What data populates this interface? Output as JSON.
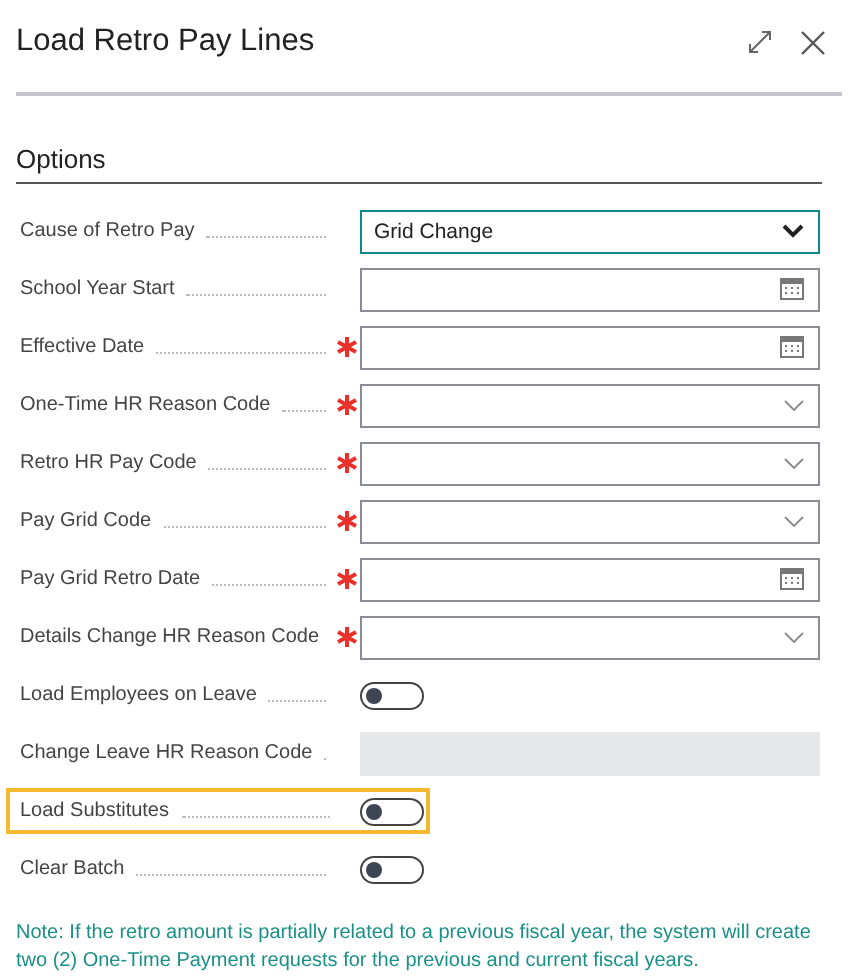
{
  "window": {
    "title": "Load Retro Pay Lines"
  },
  "section": {
    "title": "Options"
  },
  "rows": [
    {
      "label": "Cause of Retro Pay",
      "kind": "dropdown",
      "required": false,
      "value": "Grid Change",
      "focused": true,
      "highlighted": false
    },
    {
      "label": "School Year Start",
      "kind": "date",
      "required": false,
      "focused": false,
      "highlighted": false
    },
    {
      "label": "Effective Date",
      "kind": "date",
      "required": true,
      "focused": false,
      "highlighted": false
    },
    {
      "label": "One-Time HR Reason Code",
      "kind": "dropdown",
      "required": true,
      "focused": false,
      "highlighted": false
    },
    {
      "label": "Retro HR Pay Code",
      "kind": "dropdown",
      "required": true,
      "focused": false,
      "highlighted": false
    },
    {
      "label": "Pay Grid Code",
      "kind": "dropdown",
      "required": true,
      "focused": false,
      "highlighted": false
    },
    {
      "label": "Pay Grid Retro Date",
      "kind": "date",
      "required": true,
      "focused": false,
      "highlighted": false
    },
    {
      "label": "Details Change HR Reason Code",
      "kind": "dropdown",
      "required": true,
      "focused": false,
      "highlighted": false
    },
    {
      "label": "Load Employees on Leave",
      "kind": "toggle",
      "required": false,
      "on": false,
      "highlighted": false
    },
    {
      "label": "Change Leave HR Reason Code",
      "kind": "readonly",
      "required": false,
      "highlighted": false
    },
    {
      "label": "Load Substitutes",
      "kind": "toggle",
      "required": false,
      "on": false,
      "highlighted": true
    },
    {
      "label": "Clear Batch",
      "kind": "toggle",
      "required": false,
      "on": false,
      "highlighted": false
    }
  ],
  "note": "Note: If the retro amount is partially related to a previous fiscal year, the system will create two (2) One-Time Payment requests for the previous and current fiscal years."
}
